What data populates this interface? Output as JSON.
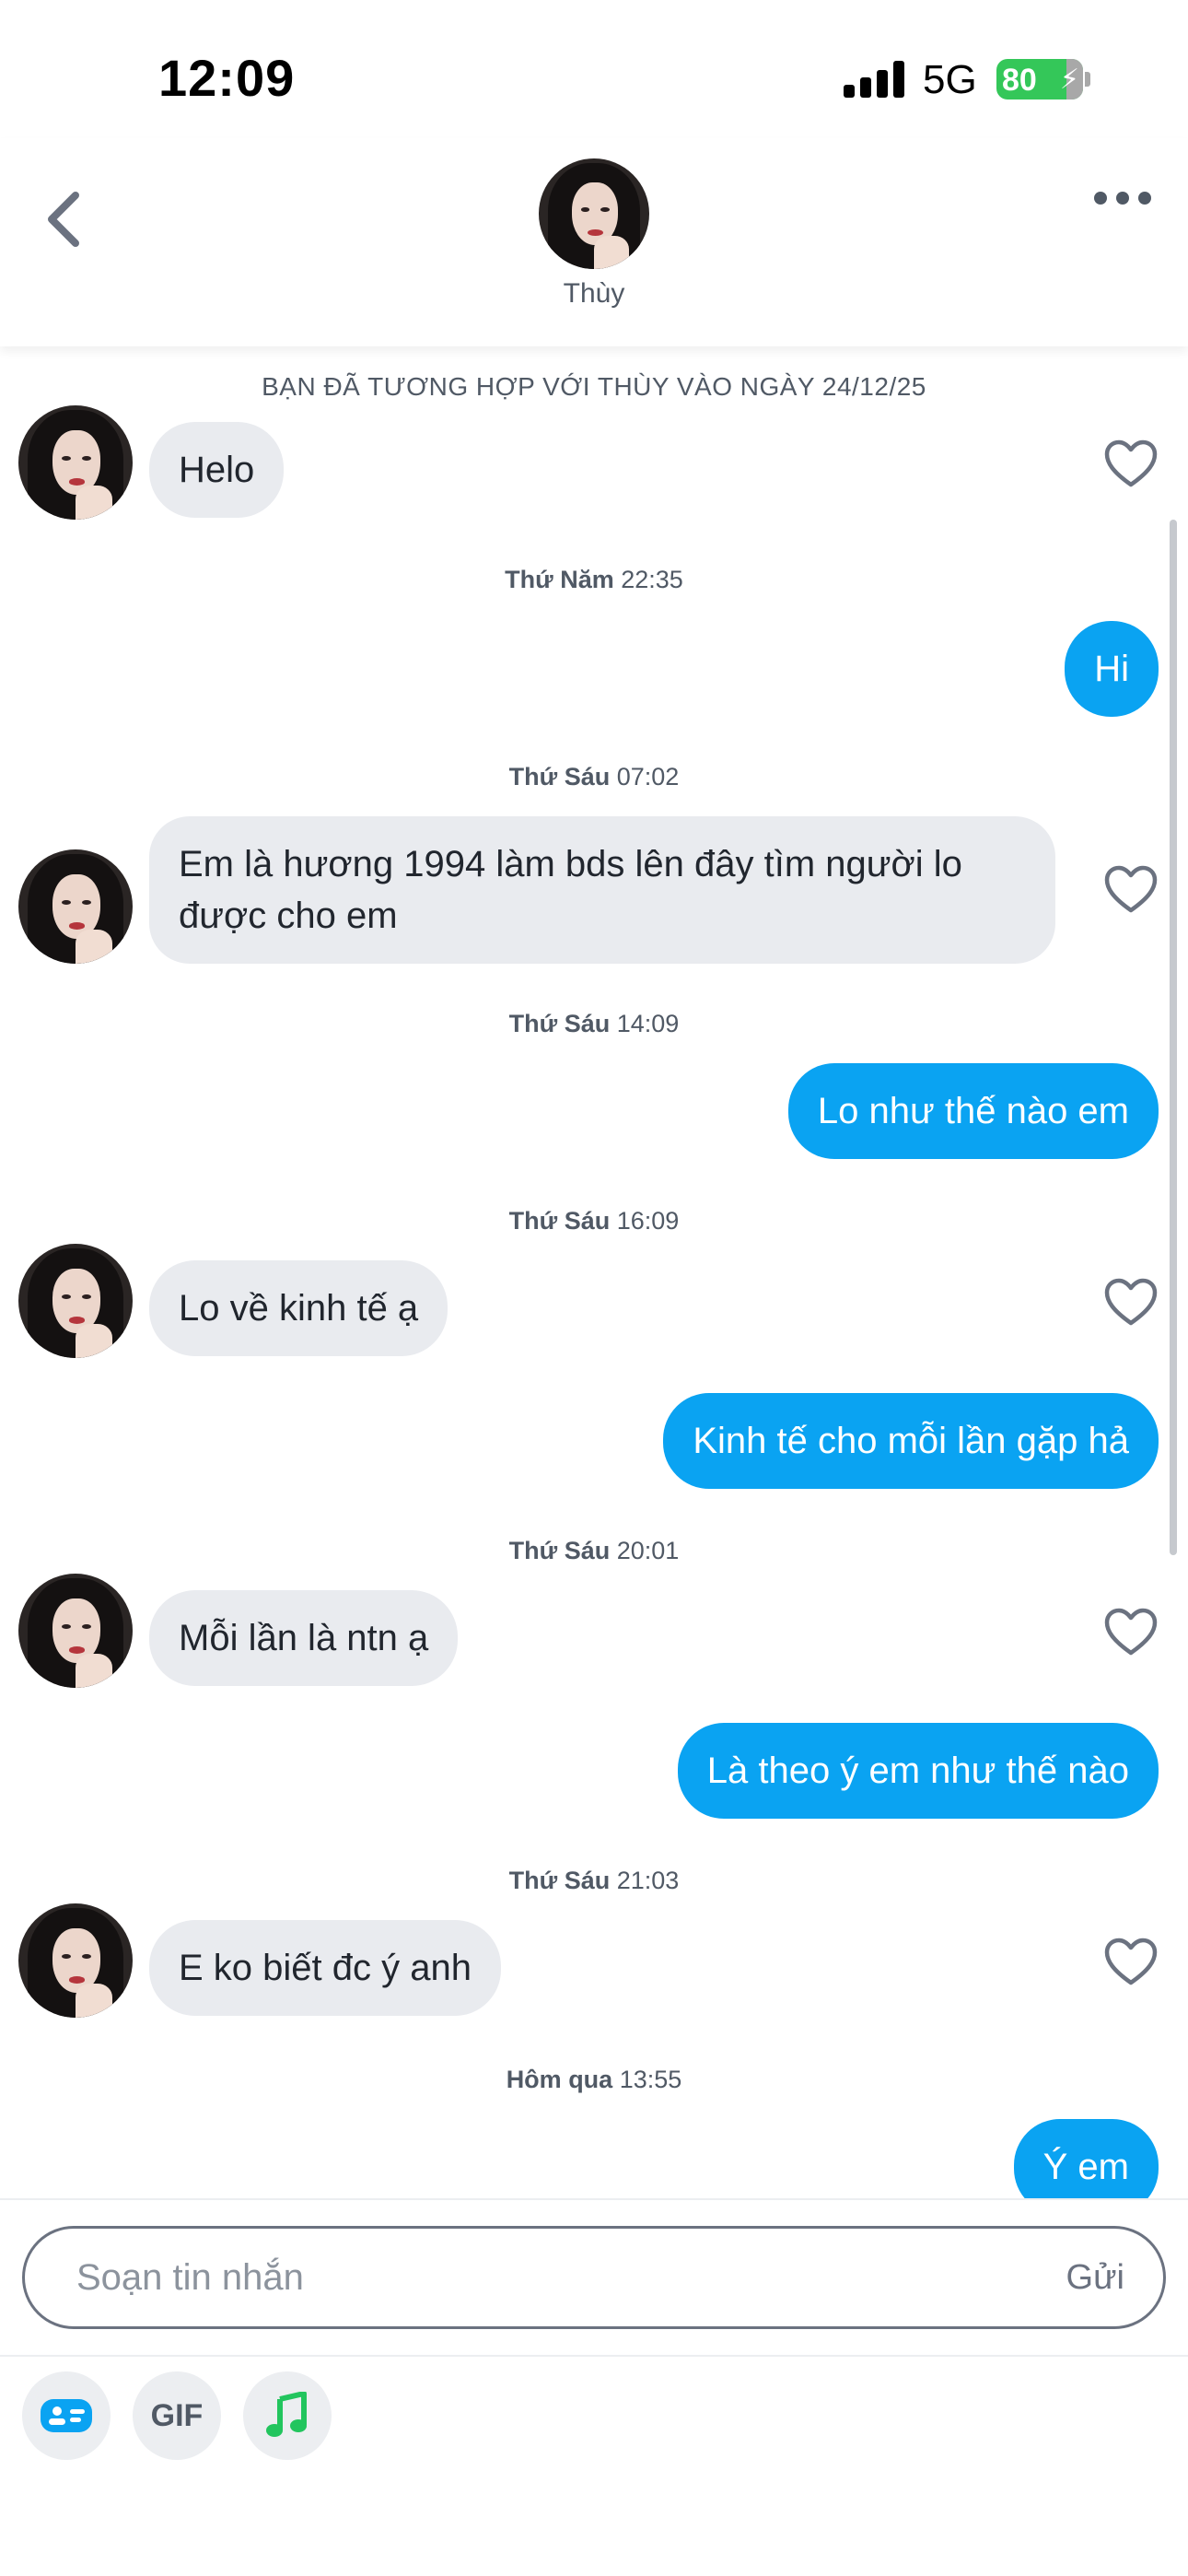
{
  "status_bar": {
    "time": "12:09",
    "network": "5G",
    "battery": "80"
  },
  "header": {
    "name": "Thùy",
    "back_icon": "chevron-left-icon",
    "more_icon": "ellipsis-icon"
  },
  "match_banner": "BẠN ĐÃ TƯƠNG HỢP VỚI THÙY VÀO NGÀY 24/12/25",
  "timestamps": [
    {
      "day": "Thứ Năm",
      "time": "22:35"
    },
    {
      "day": "Thứ Sáu",
      "time": "07:02"
    },
    {
      "day": "Thứ Sáu",
      "time": "14:09"
    },
    {
      "day": "Thứ Sáu",
      "time": "16:09"
    },
    {
      "day": "Thứ Sáu",
      "time": "20:01"
    },
    {
      "day": "Thứ Sáu",
      "time": "21:03"
    },
    {
      "day": "Hôm qua",
      "time": "13:55"
    }
  ],
  "messages": [
    {
      "from": "them",
      "text": "Helo"
    },
    {
      "from": "me",
      "text": "Hi"
    },
    {
      "from": "them",
      "text": "Em là hương 1994 làm bds lên đây tìm người lo được cho em"
    },
    {
      "from": "me",
      "text": "Lo như thế nào em"
    },
    {
      "from": "them",
      "text": "Lo về kinh tế ạ"
    },
    {
      "from": "me",
      "text": "Kinh tế cho mỗi lần gặp hả"
    },
    {
      "from": "them",
      "text": "Mỗi lần là ntn ạ"
    },
    {
      "from": "me",
      "text": "Là theo ý em như thế nào"
    },
    {
      "from": "them",
      "text": "E ko biết đc ý anh"
    },
    {
      "from": "me",
      "text": "Ý em"
    }
  ],
  "composer": {
    "placeholder": "Soạn tin nhắn",
    "send_label": "Gửi"
  },
  "tools": {
    "sticker_icon": "sticker-icon",
    "gif_label": "GIF",
    "music_icon": "music-note-icon"
  },
  "colors": {
    "outgoing_bubble": "#0aa3f2",
    "incoming_bubble": "#e9ebef",
    "battery": "#34c759",
    "music_accent": "#22c55e",
    "sticker_accent": "#0aa3f2"
  }
}
